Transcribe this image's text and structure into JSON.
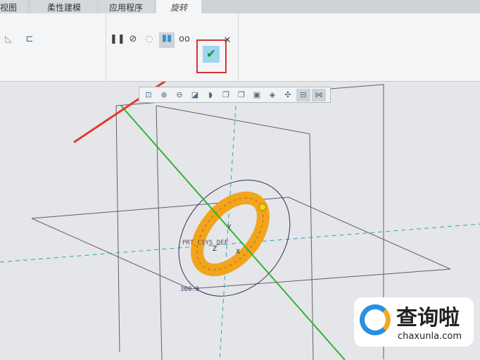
{
  "tabs": [
    "视图",
    "柔性建模",
    "应用程序",
    "旋转"
  ],
  "ribbon": {
    "icons": [
      "plane-icon",
      "sketch-icon",
      "pause-icon",
      "no-preview-icon",
      "geometry-preview-icon",
      "feature-preview-icon",
      "glasses-icon"
    ],
    "ok": "✔",
    "cancel": "✕"
  },
  "view_toolbar": [
    "refit-icon",
    "zoom-in-icon",
    "zoom-out-icon",
    "repaint-icon",
    "display-style-icon",
    "named-views-icon",
    "view-manager-icon",
    "saved-orientations-icon",
    "perspective-icon",
    "datum-display-icon",
    "annotation-display-icon",
    "spin-center-icon"
  ],
  "model": {
    "csys_label": "PRT_CSYS_DEF",
    "angle_label": "360.0",
    "axes": [
      "Y",
      "Z",
      "X"
    ]
  },
  "watermark": {
    "name": "查询啦",
    "url": "chaxunla.com"
  },
  "colors": {
    "highlight": "#d9332e",
    "torus": "#f2a51c",
    "axis": "#2fb52f"
  }
}
